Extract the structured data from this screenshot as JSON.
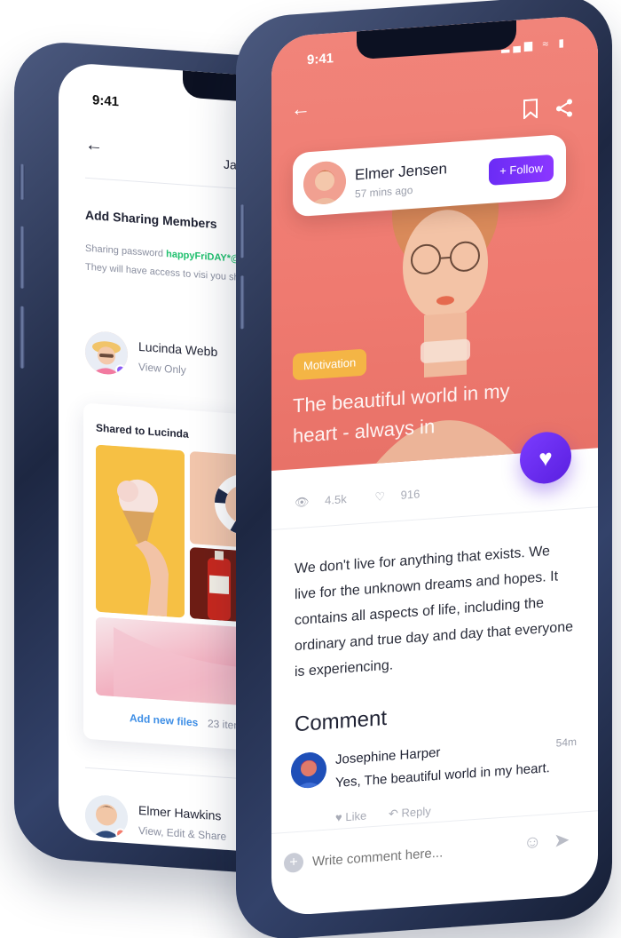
{
  "back_phone": {
    "status_time": "9:41",
    "header_user": "Jane",
    "section_title": "Add Sharing Members",
    "description_prefix": "Sharing password ",
    "password": "happyFriDAY*@398",
    "description_suffix": " members. They will have access to visi you shared with them.",
    "members": [
      {
        "name": "Lucinda Webb",
        "role": "View Only",
        "badge_color": "#8b5cf6"
      },
      {
        "name": "Elmer Hawkins",
        "role": "View, Edit & Share",
        "badge_color": "#f47c6c"
      }
    ],
    "shared_card": {
      "title": "Shared to Lucinda",
      "add_label": "Add new files",
      "count_label": "23 items,"
    }
  },
  "front_phone": {
    "status_time": "9:41",
    "author": {
      "name": "Elmer Jensen",
      "time": "57 mins ago"
    },
    "follow_label": "+ Follow",
    "tag": "Motivation",
    "title": "The beautiful world in my heart - always in",
    "stats": {
      "views": "4.5k",
      "likes": "916"
    },
    "body": "We don't live for anything that exists. We live for the unknown dreams and hopes. It contains all aspects of life, including the ordinary and true day and day that everyone is experiencing.",
    "comment_heading": "Comment",
    "comment": {
      "name": "Josephine Harper",
      "time": "54m",
      "text": "Yes, The beautiful world in my heart.",
      "like_label": "Like",
      "reply_label": "Reply"
    },
    "composer_placeholder": "Write comment here...",
    "colors": {
      "hero": "#f1847a",
      "accent": "#6b2cf5",
      "tag": "#f4b545",
      "password": "#20c06e"
    }
  }
}
